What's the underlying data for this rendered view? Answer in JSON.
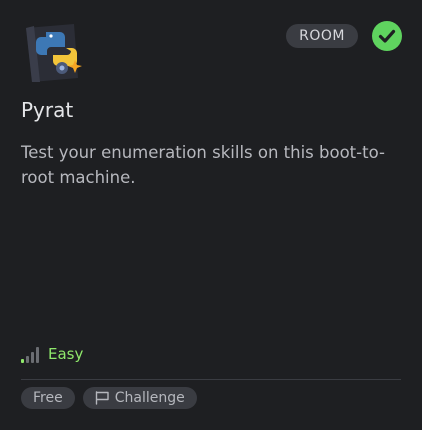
{
  "room": {
    "badge": "ROOM",
    "title": "Pyrat",
    "description": "Test your enumeration skills on this boot-to-root machine.",
    "difficulty": "Easy",
    "completed": true,
    "tags": [
      {
        "label": "Free",
        "icon": ""
      },
      {
        "label": "Challenge",
        "icon": "flag-icon"
      }
    ]
  },
  "colors": {
    "card_bg": "#1e1f22",
    "badge_bg": "#3a3c42",
    "check_green": "#5fd35f",
    "easy_green": "#8fe86b"
  }
}
